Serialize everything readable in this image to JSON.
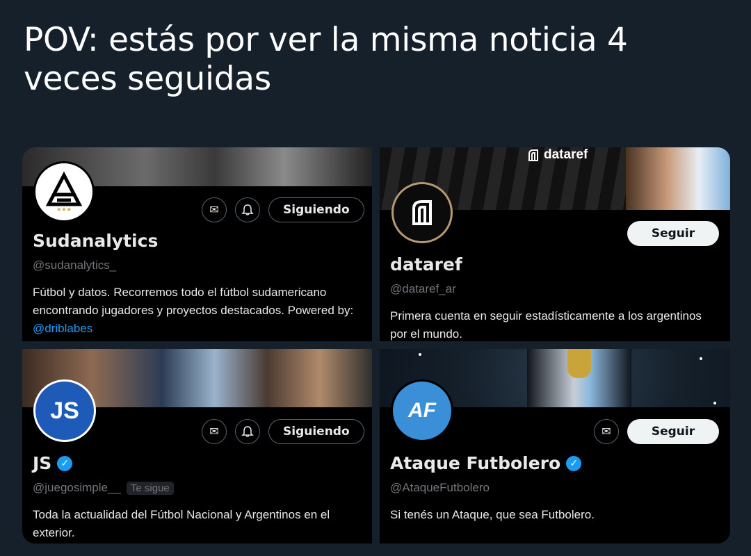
{
  "post": {
    "text": "POV: estás por ver la misma noticia 4 veces seguidas"
  },
  "cards": [
    {
      "avatar_text": "A",
      "name": "Sudanalytics",
      "handle": "@sudanalytics_",
      "follow_label": "Siguiendo",
      "bio_text": "Fútbol y datos. Recorremos todo el fútbol sudamericano encontrando jugadores y proyectos destacados. Powered by: ",
      "bio_link": "@driblabes"
    },
    {
      "banner_logo": "dataref",
      "avatar_text": "ᑎ",
      "name": "dataref",
      "handle": "@dataref_ar",
      "follow_label": "Seguir",
      "bio_text": "Primera cuenta en seguir estadísticamente a los argentinos por el mundo."
    },
    {
      "avatar_text": "JS",
      "name": "JS",
      "handle": "@juegosimple__",
      "follows_you": "Te sigue",
      "follow_label": "Siguiendo",
      "bio_text": "Toda la actualidad del Fútbol Nacional y Argentinos en el exterior."
    },
    {
      "avatar_text": "AF",
      "name": "Ataque Futbolero",
      "handle": "@AtaqueFutbolero",
      "follow_label": "Seguir",
      "bio_text": "Si tenés un Ataque, que sea Futbolero."
    }
  ],
  "icons": {
    "message": "✉",
    "notify": "🔔",
    "verified": "✓",
    "logo_mark": "⌈⌉"
  },
  "colors": {
    "background": "#15202b",
    "card": "#000000",
    "accent": "#1d9bf0",
    "muted": "#71767b"
  }
}
